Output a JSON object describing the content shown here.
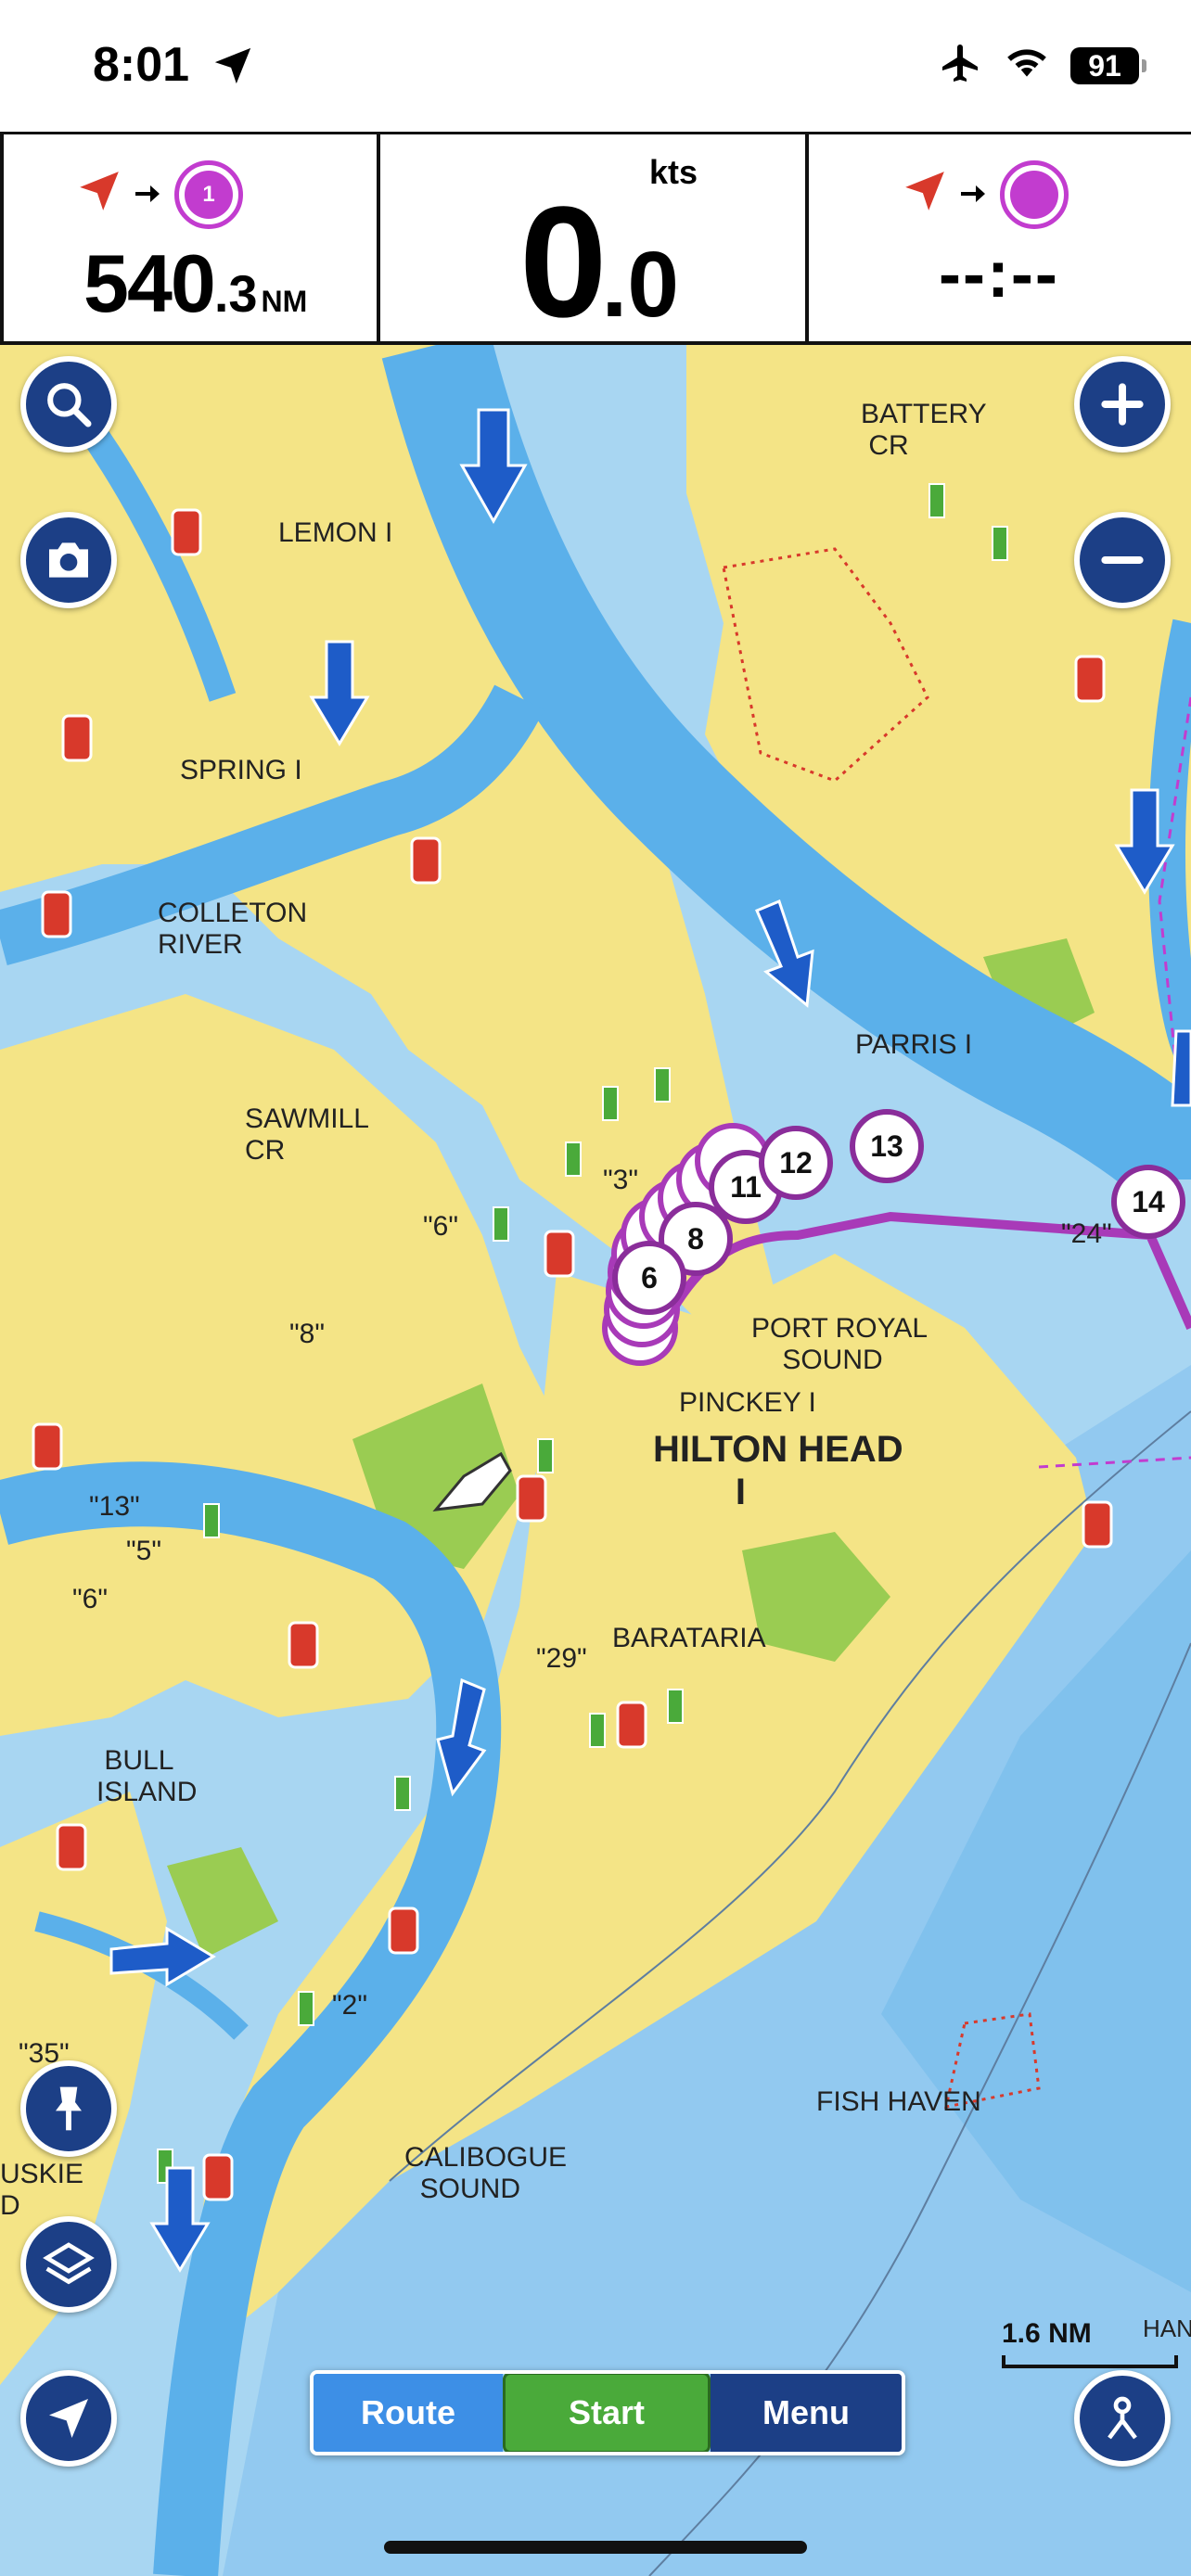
{
  "status_bar": {
    "time": "8:01",
    "battery": "91",
    "icons": [
      "location-arrow-icon",
      "airplane-icon",
      "wifi-icon",
      "battery-icon"
    ]
  },
  "data_bar": {
    "distance": {
      "integer": "540",
      "decimal": ".3",
      "unit": "NM",
      "waypoint_number": "1"
    },
    "speed": {
      "integer": "0",
      "decimal": ".0",
      "unit": "kts"
    },
    "eta": {
      "value": "--:--"
    }
  },
  "map": {
    "labels": {
      "lemon": "LEMON I",
      "battery_cr": "BATTERY\n CR",
      "spring": "SPRING I",
      "colleton": "COLLETON\nRIVER",
      "parris": "PARRIS I",
      "sawmill": "SAWMILL\nCR",
      "port_royal": "PORT ROYAL\n    SOUND",
      "pinckey": "PINCKEY I",
      "hilton_head": "HILTON HEAD\n        I",
      "baratarian": "BARATARIA",
      "bull": " BULL\nISLAND",
      "calibogue": "CALIBOGUE\n  SOUND",
      "fish_haven": "FISH HAVEN",
      "uskie": "USKIE\nD",
      "han": "HAN",
      "q3": "\"3\"",
      "q6a": "\"6\"",
      "q8": "\"8\"",
      "q13": "\"13\"",
      "q5": "\"5\"",
      "q6b": "\"6\"",
      "q29": "\"29\"",
      "q2": "\"2\"",
      "q35": "\"35\"",
      "q24": "\"24\""
    },
    "waypoints": [
      "11",
      "12",
      "13",
      "14",
      "8",
      "6"
    ],
    "scale": {
      "value": "1.6",
      "unit": "NM"
    }
  },
  "buttons": {
    "route": "Route",
    "start": "Start",
    "menu": "Menu"
  },
  "colors": {
    "land": "#f4e486",
    "shallow": "#5bb0ea",
    "deep": "#a8d6f2",
    "marsh": "#9acc52",
    "route": "#a83ab8",
    "button": "#1c3f86"
  }
}
